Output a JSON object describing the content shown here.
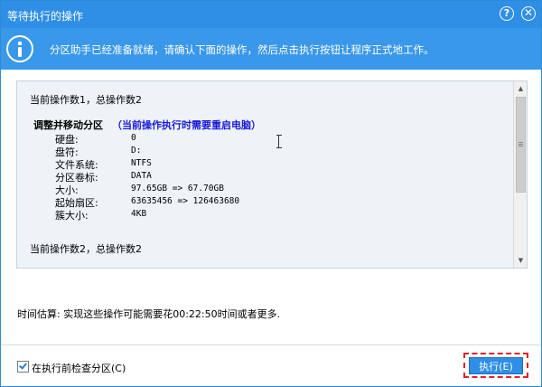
{
  "window": {
    "title": "等待执行的操作",
    "help_label": "?",
    "close_label": "✕"
  },
  "info": {
    "message": "分区助手已经准备就绪，请确认下面的操作，然后点击执行按钮让程序正式地工作。"
  },
  "operations": {
    "op1_header": "当前操作数1，总操作数2",
    "op1_title": "调整并移动分区",
    "op1_note": "（当前操作执行时需要重启电脑）",
    "fields": [
      {
        "label": "硬盘:",
        "value": "0"
      },
      {
        "label": "盘符:",
        "value": "D:"
      },
      {
        "label": "文件系统:",
        "value": "NTFS"
      },
      {
        "label": "分区卷标:",
        "value": "DATA"
      },
      {
        "label": "大小:",
        "value": "97.65GB => 67.70GB"
      },
      {
        "label": "起始扇区:",
        "value": "63635456 => 126463680"
      },
      {
        "label": "簇大小:",
        "value": "4KB"
      }
    ],
    "op2_header": "当前操作数2，总操作数2"
  },
  "time_estimate": "时间估算: 实现这些操作可能需要花00:22:50时间或者更多.",
  "footer": {
    "checkbox_label": "在执行前检查分区(C)",
    "checkbox_checked": true,
    "execute_label": "执行(E)"
  },
  "colors": {
    "titlebar": "#2f8ee5",
    "infobar": "#3a98ea",
    "note_text": "#1a1adb",
    "focus_outline": "#e2202a"
  }
}
